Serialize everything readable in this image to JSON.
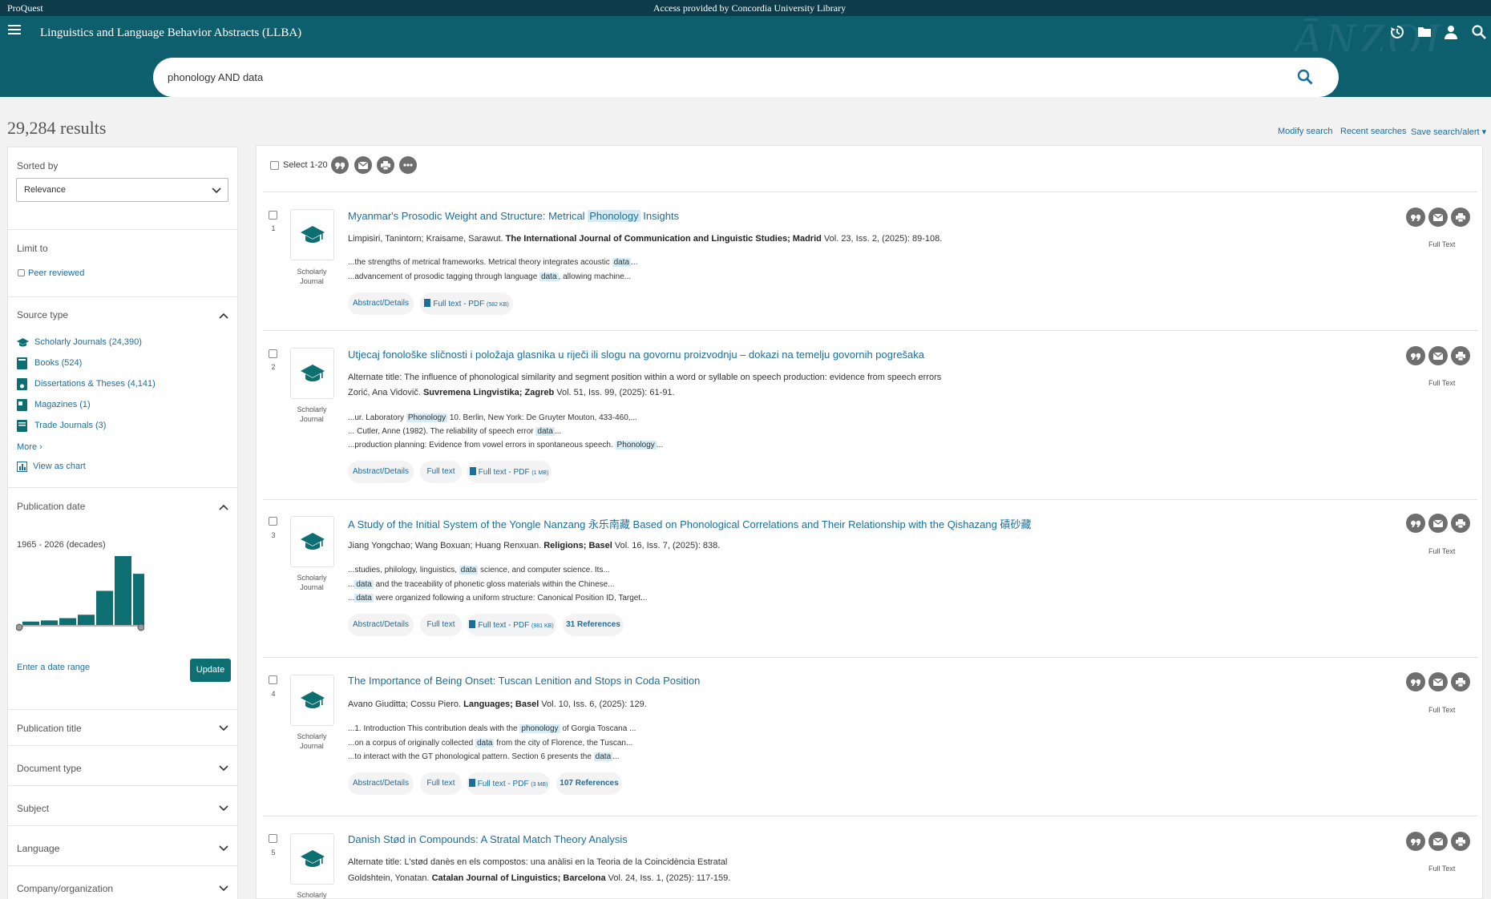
{
  "topbar": {
    "brand": "ProQuest",
    "access": "Access provided by Concordia University Library"
  },
  "header": {
    "db_title": "Linguistics and Language Behavior Abstracts (LLBA)",
    "decor_text": "ĀNZOI"
  },
  "search": {
    "query": "phonology AND data"
  },
  "results": {
    "count": "29,284 results"
  },
  "toplinks": {
    "modify": "Modify search",
    "recent": "Recent searches",
    "save": "Save search/alert",
    "save_caret": "▾"
  },
  "sidebar": {
    "sorted_by_label": "Sorted by",
    "sort_value": "Relevance",
    "limit_to_label": "Limit to",
    "peer_reviewed": "Peer reviewed",
    "source_type_label": "Source type",
    "source_types": [
      "Scholarly Journals (24,390)",
      "Books (524)",
      "Dissertations & Theses (4,141)",
      "Magazines (1)",
      "Trade Journals (3)"
    ],
    "more": "More ›",
    "view_chart": "View as chart",
    "pubdate_label": "Publication date",
    "pubdate_range": "1965 - 2026 (decades)",
    "enter_range": "Enter a date range",
    "update": "Update",
    "facets": [
      "Publication title",
      "Document type",
      "Subject",
      "Language",
      "Company/organization"
    ]
  },
  "histogram": {
    "values": [
      3,
      4,
      6,
      9,
      30,
      62,
      45
    ],
    "max": 62
  },
  "toolbar": {
    "select_label": "Select 1-20"
  },
  "record_type": {
    "line1": "Scholarly",
    "line2": "Journal"
  },
  "fulltext_label": "Full Text",
  "records": [
    {
      "num": "1",
      "title_parts": [
        "Myanmar's Prosodic Weight and Structure: Metrical ",
        "Phonology",
        " Insights"
      ],
      "authors": "Limpisiri, Tanintorn; Kraisame, Sarawut.",
      "source_bold": "The International Journal of Communication and Linguistic Studies; Madrid",
      "source_rest": " Vol. 23, Iss. 2,  (2025): 89-108.",
      "snippets": [
        [
          "...the strengths of metrical frameworks. Metrical theory integrates acoustic ",
          "data",
          "..."
        ],
        [
          "...advancement of prosodic tagging through language ",
          "data",
          ", allowing machine..."
        ]
      ],
      "pills": {
        "abstract": "Abstract/Details",
        "pdf": "Full text - PDF",
        "pdf_size": "(582 KB)"
      }
    },
    {
      "num": "2",
      "title_parts": [
        "Utjecaj fonološke sličnosti i položaja glasnika u riječi ili slogu na govornu proizvodnju – dokazi na temelju govornih pogrešaka"
      ],
      "alternate": "Alternate title: The influence of phonological similarity and segment position within a word or syllable on speech production: evidence from speech errors",
      "authors": "Zorić, Ana Vidovič.",
      "source_bold": "Suvremena Lingvistika; Zagreb",
      "source_rest": " Vol. 51, Iss. 99,  (2025): 61-91.",
      "snippets": [
        [
          "...ur. Laboratory ",
          "Phonology",
          " 10. Berlin, New York: De Gruyter Mouton, 433-460,..."
        ],
        [
          "... Cutler, Anne (1982). The reliability of speech error ",
          "data",
          "..."
        ],
        [
          "...production planning: Evidence from vowel errors in spontaneous speech. ",
          "Phonology",
          "..."
        ]
      ],
      "pills": {
        "abstract": "Abstract/Details",
        "fulltext": "Full text",
        "pdf": "Full text - PDF",
        "pdf_size": "(1 MB)"
      }
    },
    {
      "num": "3",
      "title_parts": [
        "A Study of the Initial System of the Yongle Nanzang 永乐南藏 Based on Phonological Correlations and Their Relationship with the Qishazang 磧砂藏"
      ],
      "authors": "Jiang Yongchao; Wang Boxuan; Huang Renxuan.",
      "source_bold": "Religions; Basel",
      "source_rest": " Vol. 16, Iss. 7,  (2025): 838.",
      "snippets": [
        [
          "...studies, philology, linguistics, ",
          "data",
          " science, and computer science. Its..."
        ],
        [
          "...",
          "data",
          " and the traceability of phonetic gloss materials within the Chinese..."
        ],
        [
          "...",
          "data",
          " were organized following a uniform structure: Canonical Position ID, Target..."
        ]
      ],
      "pills": {
        "abstract": "Abstract/Details",
        "fulltext": "Full text",
        "pdf": "Full text - PDF",
        "pdf_size": "(981 KB)",
        "refs": "31 References"
      }
    },
    {
      "num": "4",
      "title_parts": [
        "The Importance of Being Onset: Tuscan Lenition and Stops in Coda Position"
      ],
      "authors": "Avano Giuditta; Cossu Piero.",
      "source_bold": "Languages; Basel",
      "source_rest": " Vol. 10, Iss. 6,  (2025): 129.",
      "snippets": [
        [
          "...1. Introduction This contribution deals with the ",
          "phonology",
          " of Gorgia Toscana ..."
        ],
        [
          "...on a corpus of originally collected ",
          "data",
          " from the city of Florence, the Tuscan..."
        ],
        [
          "...to interact with the GT phonological pattern. Section 6 presents the ",
          "data",
          "..."
        ]
      ],
      "pills": {
        "abstract": "Abstract/Details",
        "fulltext": "Full text",
        "pdf": "Full text - PDF",
        "pdf_size": "(3 MB)",
        "refs": "107 References"
      }
    },
    {
      "num": "5",
      "title_parts": [
        "Danish Stød in Compounds: A Stratal Match Theory Analysis"
      ],
      "alternate": "Alternate title: L'stød danès en els compostos: una anàlisi en la Teoria de la Coincidència Estratal",
      "authors": "Goldshtein, Yonatan.",
      "source_bold": "Catalan Journal of Linguistics; Barcelona",
      "source_rest": " Vol. 24, Iss. 1,  (2025): 117-159.",
      "snippets": [],
      "pills": {}
    }
  ],
  "colors": {
    "header": "#0e5f6e",
    "topbar": "#0d3b4a",
    "link": "#1a6e9c",
    "accent": "#0e6f73",
    "highlight": "#d5ecf6"
  },
  "icons": [
    "menu-icon",
    "history-icon",
    "folder-icon",
    "user-icon",
    "search-icon",
    "cite-icon",
    "email-icon",
    "print-icon",
    "more-icon",
    "scholarly-journal-icon",
    "chevron-icon"
  ]
}
